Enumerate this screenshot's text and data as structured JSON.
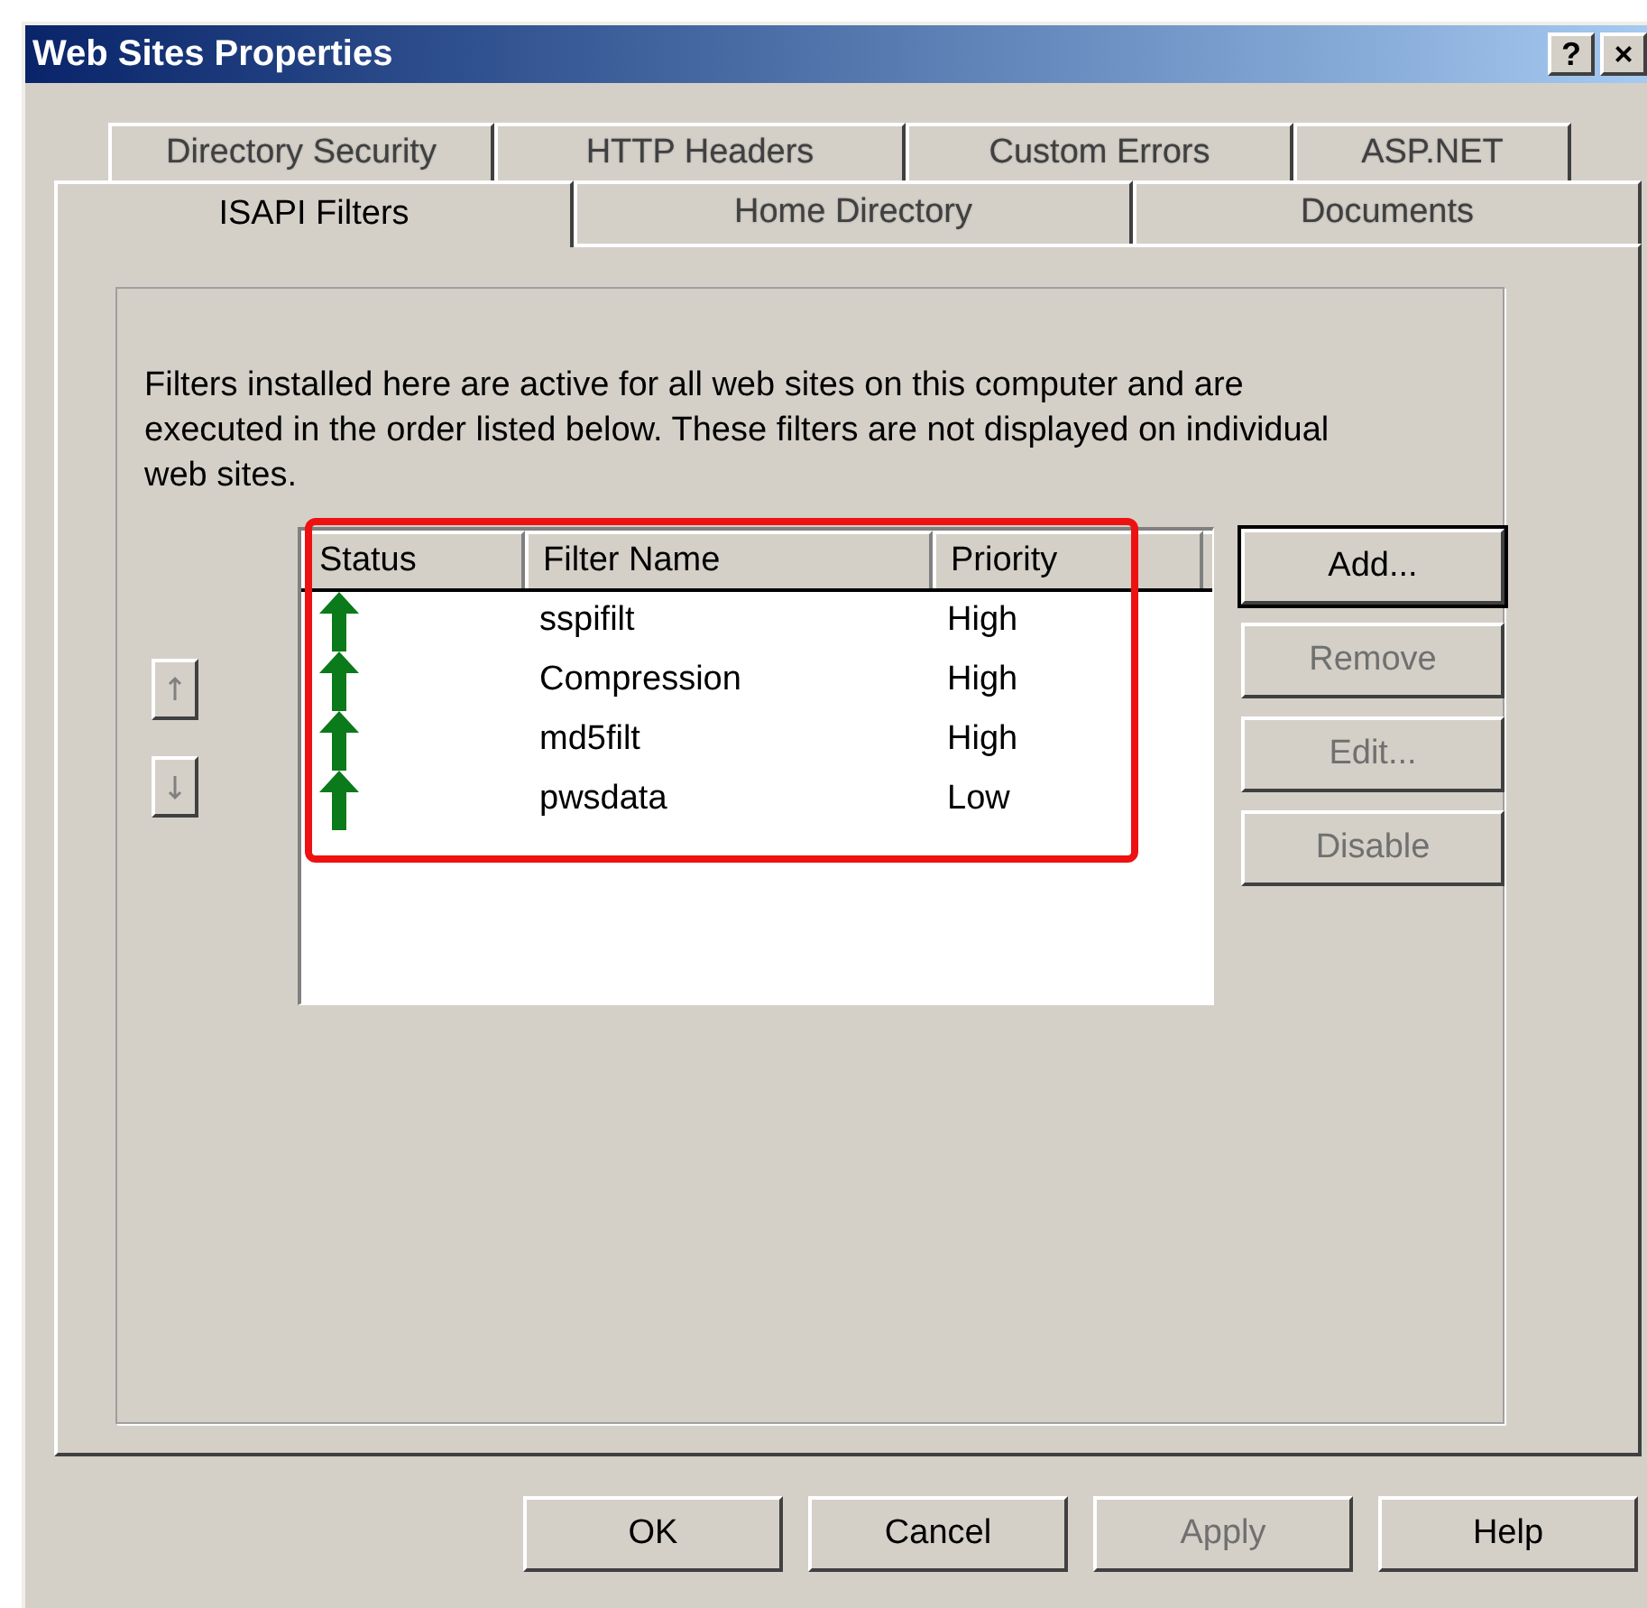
{
  "window": {
    "title": "Web Sites Properties",
    "controls": [
      "?",
      "×"
    ]
  },
  "tab_rows": [
    [
      {
        "label": "Directory Security",
        "selected": false
      },
      {
        "label": "HTTP Headers",
        "selected": false
      },
      {
        "label": "Custom Errors",
        "selected": false
      },
      {
        "label": "ASP.NET",
        "selected": false
      }
    ],
    [
      {
        "label": "ISAPI Filters",
        "selected": true
      },
      {
        "label": "Home Directory",
        "selected": false
      },
      {
        "label": "Documents",
        "selected": false
      }
    ]
  ],
  "description": "Filters installed here are active for all web sites on this computer and are executed in the order listed below.  These filters are not displayed on individual web sites.",
  "order_buttons": [
    {
      "kind": "up",
      "disabled": true
    },
    {
      "kind": "down",
      "disabled": true
    }
  ],
  "filter_list": {
    "columns": [
      "Status",
      "Filter Name",
      "Priority"
    ],
    "rows": [
      {
        "name": "sspifilt",
        "priority": "High"
      },
      {
        "name": "Compression",
        "priority": "High"
      },
      {
        "name": "md5filt",
        "priority": "High"
      },
      {
        "name": "pwsdata",
        "priority": "Low"
      }
    ]
  },
  "side_buttons": [
    {
      "label": "Add...",
      "disabled": false,
      "default": true
    },
    {
      "label": "Remove",
      "disabled": true,
      "default": false
    },
    {
      "label": "Edit...",
      "disabled": true,
      "default": false
    },
    {
      "label": "Disable",
      "disabled": true,
      "default": false
    }
  ],
  "dialog_buttons": [
    {
      "label": "OK",
      "disabled": false
    },
    {
      "label": "Cancel",
      "disabled": false
    },
    {
      "label": "Apply",
      "disabled": true
    },
    {
      "label": "Help",
      "disabled": false
    }
  ]
}
